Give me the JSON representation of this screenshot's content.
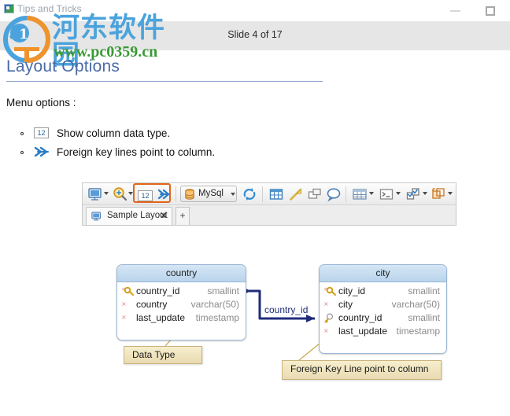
{
  "window": {
    "title": "Tips and Tricks",
    "icon": "app-icon",
    "minimize_label": "–",
    "maximize_label": "□"
  },
  "slide": {
    "counter": "Slide 4 of 17",
    "heading": "Layout Options"
  },
  "watermark": {
    "site_name_cn": "河东软件园",
    "url": "www.pc0359.cn",
    "brand_blue": "#4ba3dd",
    "brand_green": "#3a9a36",
    "brand_orange": "#f0932b"
  },
  "body": {
    "intro": "Menu options :",
    "bullets": [
      {
        "icon": "number-12-icon",
        "icon_label": "12",
        "text": "Show column data type."
      },
      {
        "icon": "double-chevron-right-icon",
        "icon_label": "»",
        "text": "Foreign key lines point to column."
      }
    ]
  },
  "toolbar": {
    "highlight_color": "#e2651a",
    "groups": [
      {
        "items": [
          {
            "name": "display-monitor-icon",
            "label": "",
            "has_caret": true
          },
          {
            "name": "zoom-magnifier-icon",
            "label": "",
            "has_caret": true
          },
          {
            "name": "show-data-type-icon",
            "label": "12",
            "has_caret": false,
            "highlighted": true
          },
          {
            "name": "foreign-key-line-icon",
            "label": "»",
            "has_caret": false,
            "highlighted": true
          }
        ]
      },
      {
        "items": [
          {
            "name": "database-dropdown",
            "label": "MySql",
            "has_caret": true
          },
          {
            "name": "refresh-icon",
            "label": "",
            "has_caret": false
          }
        ]
      },
      {
        "items": [
          {
            "name": "new-table-icon",
            "label": "",
            "has_caret": false
          },
          {
            "name": "new-relation-icon",
            "label": "",
            "has_caret": false
          },
          {
            "name": "new-view-icon",
            "label": "",
            "has_caret": false
          },
          {
            "name": "note-bubble-icon",
            "label": "",
            "has_caret": false
          }
        ]
      },
      {
        "items": [
          {
            "name": "grid-layout-icon",
            "label": "",
            "has_caret": true
          },
          {
            "name": "console-icon",
            "label": "",
            "has_caret": true
          },
          {
            "name": "validate-icon",
            "label": "",
            "has_caret": true
          },
          {
            "name": "layout-arrange-icon",
            "label": "",
            "has_caret": true
          }
        ]
      }
    ],
    "tabs": {
      "active": "Sample Layout",
      "close_label": "✕",
      "add_label": "+"
    }
  },
  "diagram": {
    "tables": [
      {
        "name": "country",
        "columns": [
          {
            "key": "primary",
            "name": "country_id",
            "type": "smallint"
          },
          {
            "key": "none",
            "name": "country",
            "type": "varchar(50)"
          },
          {
            "key": "none",
            "name": "last_update",
            "type": "timestamp"
          }
        ]
      },
      {
        "name": "city",
        "columns": [
          {
            "key": "primary",
            "name": "city_id",
            "type": "smallint"
          },
          {
            "key": "none",
            "name": "city",
            "type": "varchar(50)"
          },
          {
            "key": "foreign",
            "name": "country_id",
            "type": "smallint"
          },
          {
            "key": "none",
            "name": "last_update",
            "type": "timestamp"
          }
        ]
      }
    ],
    "relation_label": "country_id",
    "relation_color": "#1f2d7a",
    "callouts": [
      {
        "name": "data-type-callout",
        "text": "Data Type"
      },
      {
        "name": "foreign-key-callout",
        "text": "Foreign Key Line point to column"
      }
    ]
  }
}
